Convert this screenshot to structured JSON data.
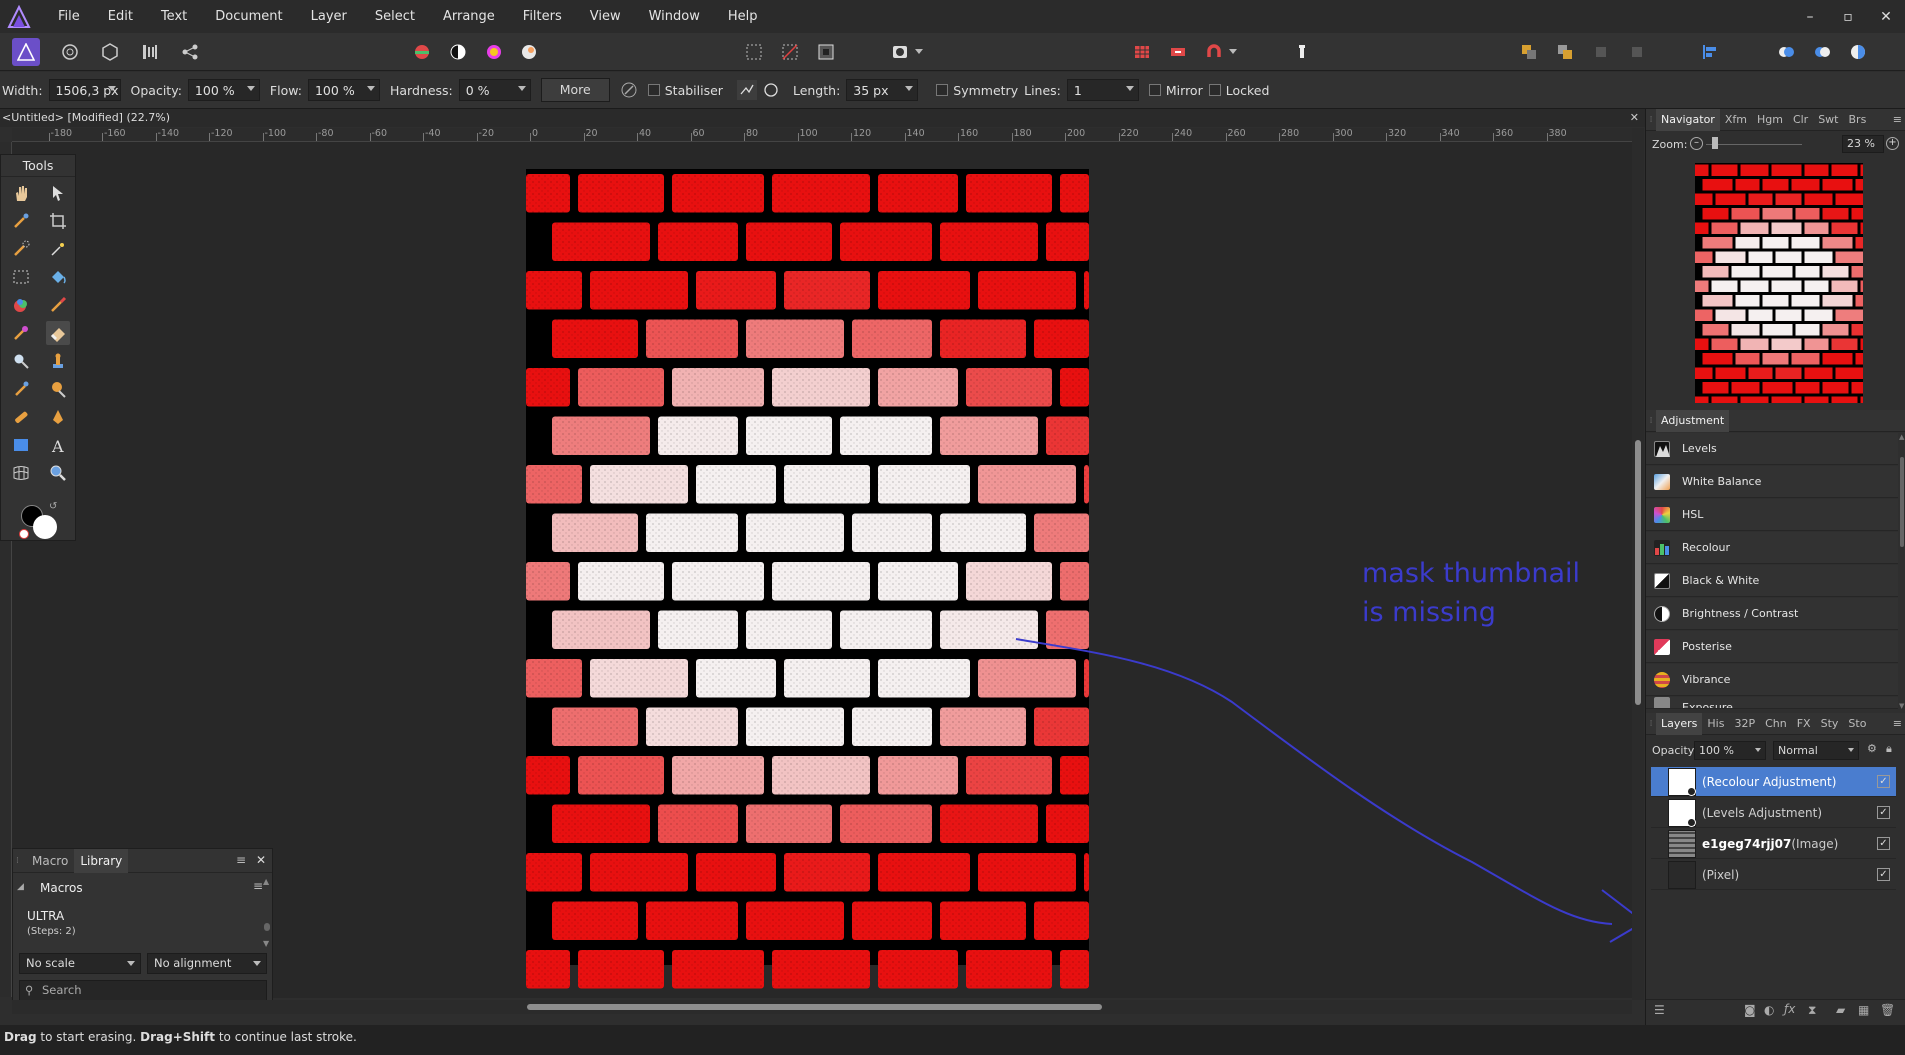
{
  "menubar": {
    "items": [
      "File",
      "Edit",
      "Text",
      "Document",
      "Layer",
      "Select",
      "Arrange",
      "Filters",
      "View",
      "Window",
      "Help"
    ],
    "window_controls": [
      "–",
      "▫",
      "✕"
    ]
  },
  "context_bar": {
    "width_label": "Width:",
    "width_value": "1506,3 px",
    "opacity_label": "Opacity:",
    "opacity_value": "100 %",
    "flow_label": "Flow:",
    "flow_value": "100 %",
    "hardness_label": "Hardness:",
    "hardness_value": "0 %",
    "more_label": "More",
    "stabiliser_label": "Stabiliser",
    "length_label": "Length:",
    "length_value": "35 px",
    "symmetry_label": "Symmetry",
    "lines_label": "Lines:",
    "lines_value": "1",
    "mirror_label": "Mirror",
    "locked_label": "Locked"
  },
  "document": {
    "title": "<Untitled> [Modified] (22.7%)",
    "close_glyph": "✕"
  },
  "ruler": {
    "ticks": [
      "-180",
      "-160",
      "-140",
      "-120",
      "-100",
      "-80",
      "-60",
      "-40",
      "-20",
      "0",
      "20",
      "40",
      "60",
      "80",
      "100",
      "120",
      "140",
      "160",
      "180",
      "200",
      "220",
      "240",
      "260",
      "280",
      "300",
      "320",
      "340",
      "360",
      "380"
    ]
  },
  "tools_panel": {
    "title": "Tools"
  },
  "macro_panel": {
    "tabs": [
      "Macro",
      "Library"
    ],
    "section_title": "Macros",
    "macro_name": "ULTRA",
    "macro_steps": "(Steps: 2)",
    "scale_select": "No scale",
    "align_select": "No alignment",
    "search_placeholder": "Search"
  },
  "navigator": {
    "tabs": [
      "Navigator",
      "Xfm",
      "Hgm",
      "Clr",
      "Swt",
      "Brs"
    ],
    "zoom_label": "Zoom:",
    "zoom_value": "23 %"
  },
  "adjustment": {
    "tab": "Adjustment",
    "items": [
      {
        "label": "Levels",
        "color": "#cfcfcf"
      },
      {
        "label": "White Balance",
        "color": "#5aa0e0"
      },
      {
        "label": "HSL",
        "color": "#d04fd0"
      },
      {
        "label": "Recolour",
        "color": "#e05050"
      },
      {
        "label": "Black & White",
        "color": "#ffffff"
      },
      {
        "label": "Brightness / Contrast",
        "color": "#e8e8e8"
      },
      {
        "label": "Posterise",
        "color": "#e03a5a"
      },
      {
        "label": "Vibrance",
        "color": "#e8b020"
      },
      {
        "label": "Exposure",
        "color": "#a0a0a0"
      }
    ]
  },
  "layers": {
    "tabs": [
      "Layers",
      "His",
      "32P",
      "Chn",
      "FX",
      "Sty",
      "Sto"
    ],
    "opacity_label": "Opacity:",
    "opacity_value": "100 %",
    "blend_mode": "Normal",
    "items": [
      {
        "name": "(Recolour Adjustment)",
        "type": ""
      },
      {
        "name": "(Levels Adjustment)",
        "type": ""
      },
      {
        "name": "e1geg74rjj07",
        "type": " (Image)"
      },
      {
        "name": "(Pixel)",
        "type": ""
      }
    ],
    "visible_check": "✓"
  },
  "annotation": {
    "line1": "mask thumbnail",
    "line2": "is missing",
    "color": "#3b3bcc"
  },
  "status": {
    "bold1": "Drag",
    "text1": " to start erasing. ",
    "bold2": "Drag+Shift",
    "text2": " to continue last stroke."
  },
  "colors": {
    "brick_red": "#e81010",
    "selection": "#4a7dcf"
  }
}
